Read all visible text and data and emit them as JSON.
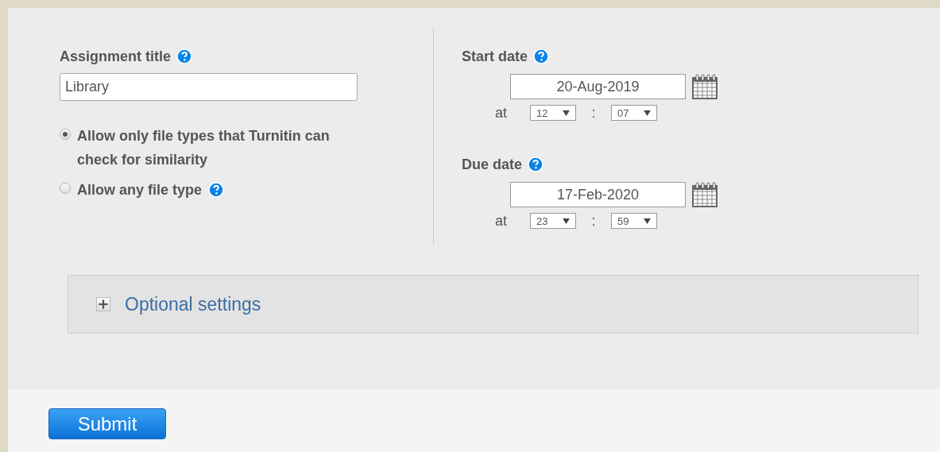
{
  "assignment_title": {
    "label": "Assignment title",
    "value": "Library"
  },
  "file_type_options": [
    {
      "label": "Allow only file types that Turnitin can check for similarity",
      "selected": true,
      "help": false
    },
    {
      "label": "Allow any file type",
      "selected": false,
      "help": true
    }
  ],
  "dates": [
    {
      "label": "Start date",
      "date": "20-Aug-2019",
      "at": "at",
      "hour": "12",
      "separator": ":",
      "minute": "07"
    },
    {
      "label": "Due date",
      "date": "17-Feb-2020",
      "at": "at",
      "hour": "23",
      "separator": ":",
      "minute": "59"
    }
  ],
  "optional_settings": {
    "label": "Optional settings",
    "expanded": false
  },
  "submit": "Submit"
}
